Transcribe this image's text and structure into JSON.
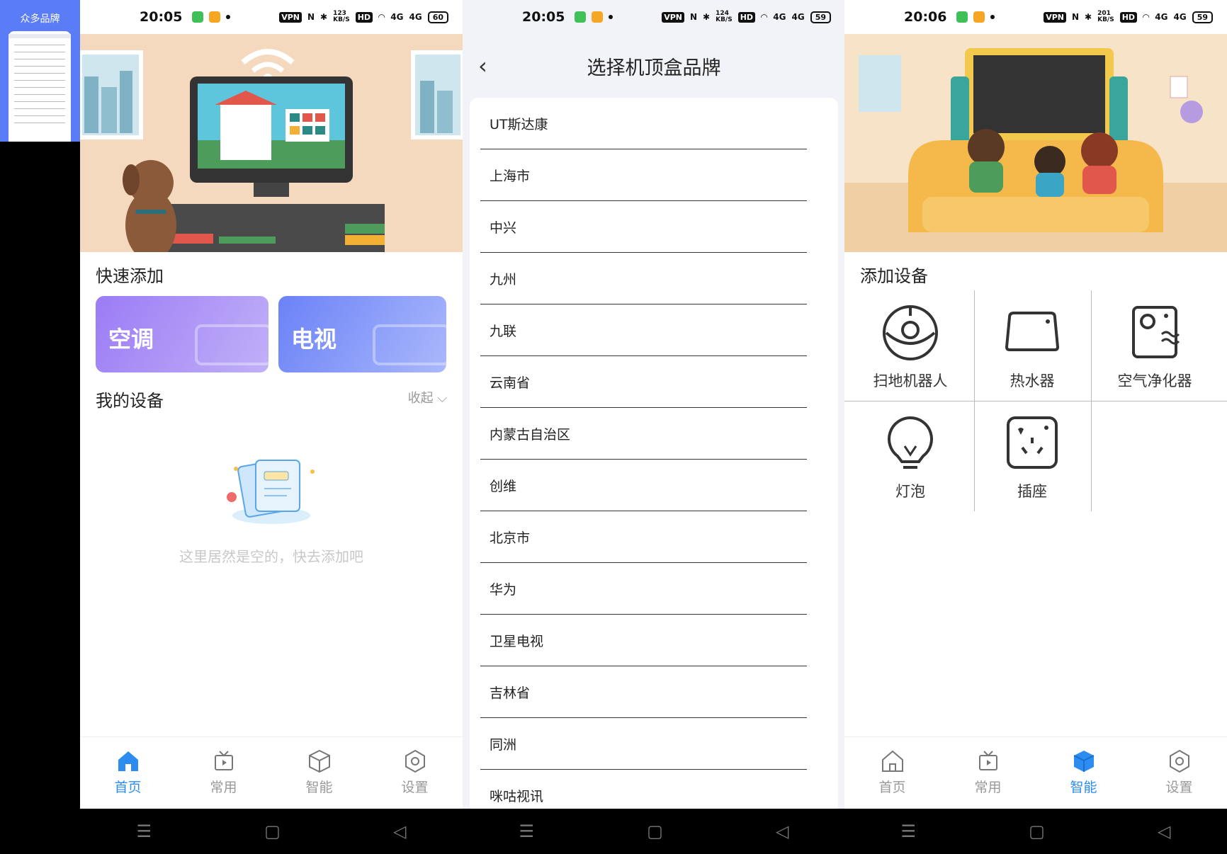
{
  "thumbnail": {
    "title": "众多品牌"
  },
  "status_bars": [
    {
      "time": "20:05",
      "speed": "123\nKB/S",
      "battery": "60"
    },
    {
      "time": "20:05",
      "speed": "124\nKB/S",
      "battery": "59"
    },
    {
      "time": "20:06",
      "speed": "201\nKB/S",
      "battery": "59"
    }
  ],
  "status_common": {
    "vpn": "VPN",
    "nfc": "N",
    "hd": "HD",
    "net1": "4G",
    "net2": "4G"
  },
  "home": {
    "quick_add_title": "快速添加",
    "quick_buttons": [
      "空调",
      "电视"
    ],
    "my_devices_title": "我的设备",
    "collapse_label": "收起",
    "empty_text": "这里居然是空的，快去添加吧"
  },
  "brand_page": {
    "title": "选择机顶盒品牌",
    "brands": [
      "UT斯达康",
      "上海市",
      "中兴",
      "九州",
      "九联",
      "云南省",
      "内蒙古自治区",
      "创维",
      "北京市",
      "华为",
      "卫星电视",
      "吉林省",
      "同洲",
      "咪咕视讯"
    ]
  },
  "smart": {
    "add_device_title": "添加设备",
    "devices": [
      {
        "label": "扫地机器人",
        "icon": "robot-vacuum-icon"
      },
      {
        "label": "热水器",
        "icon": "water-heater-icon"
      },
      {
        "label": "空气净化器",
        "icon": "air-purifier-icon"
      },
      {
        "label": "灯泡",
        "icon": "bulb-icon"
      },
      {
        "label": "插座",
        "icon": "socket-icon"
      }
    ]
  },
  "tabs": [
    "首页",
    "常用",
    "智能",
    "设置"
  ],
  "colors": {
    "accent": "#2c8cf0",
    "quick_ac": "#9b7cf5",
    "quick_tv": "#6b82f7"
  }
}
